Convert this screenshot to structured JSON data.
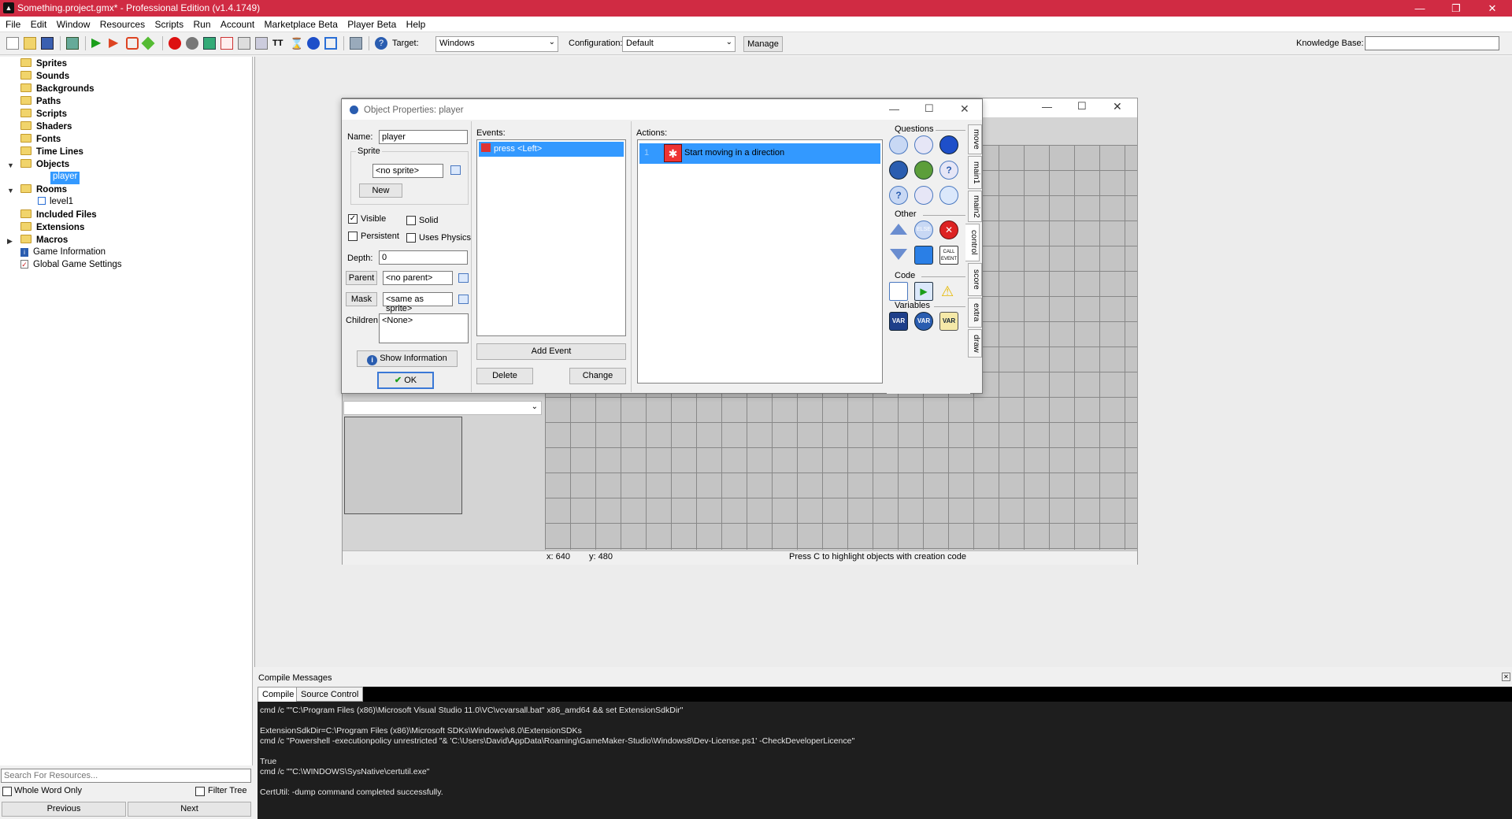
{
  "window": {
    "title": "Something.project.gmx* - Professional Edition (v1.4.1749)"
  },
  "menu": [
    "File",
    "Edit",
    "Window",
    "Resources",
    "Scripts",
    "Run",
    "Account",
    "Marketplace Beta",
    "Player Beta",
    "Help"
  ],
  "toolbar": {
    "target_label": "Target:",
    "target_value": "Windows",
    "config_label": "Configuration:",
    "config_value": "Default",
    "manage_label": "Manage",
    "kb_label": "Knowledge Base:"
  },
  "tree": {
    "sprites": "Sprites",
    "sounds": "Sounds",
    "backgrounds": "Backgrounds",
    "paths": "Paths",
    "scripts": "Scripts",
    "shaders": "Shaders",
    "fonts": "Fonts",
    "timelines": "Time Lines",
    "objects": "Objects",
    "player": "player",
    "rooms": "Rooms",
    "level1": "level1",
    "included": "Included Files",
    "extensions": "Extensions",
    "macros": "Macros",
    "gameinfo": "Game Information",
    "globalsettings": "Global Game Settings"
  },
  "search": {
    "placeholder": "Search For Resources...",
    "whole_word": "Whole Word Only",
    "filter_tree": "Filter Tree",
    "previous": "Previous",
    "next": "Next"
  },
  "dialog": {
    "title": "Object Properties: player",
    "name_label": "Name:",
    "name_value": "player",
    "sprite_group": "Sprite",
    "sprite_value": "<no sprite>",
    "new_btn": "New",
    "visible": "Visible",
    "solid": "Solid",
    "persistent": "Persistent",
    "uses_physics": "Uses Physics",
    "depth_label": "Depth:",
    "depth_value": "0",
    "parent_btn": "Parent",
    "parent_value": "<no parent>",
    "mask_btn": "Mask",
    "mask_value": "<same as sprite>",
    "children_label": "Children:",
    "children_value": "<None>",
    "show_info": "Show Information",
    "ok": "OK",
    "events_label": "Events:",
    "event_item": "press <Left>",
    "add_event": "Add Event",
    "delete": "Delete",
    "change": "Change",
    "actions_label": "Actions:",
    "action_item": "Start moving in a direction",
    "questions": "Questions",
    "other": "Other",
    "code": "Code",
    "variables": "Variables",
    "tabs": [
      "move",
      "main1",
      "main2",
      "control",
      "score",
      "extra",
      "draw"
    ],
    "else_text": "ELSE",
    "call_event": "CALL EVENT",
    "var": "VAR"
  },
  "room": {
    "x": "x: 640",
    "y": "y: 480",
    "hint": "Press C to highlight objects with creation code"
  },
  "compile": {
    "title": "Compile Messages",
    "tab_compile": "Compile",
    "tab_source": "Source Control",
    "lines": [
      "cmd /c \"\"C:\\Program Files (x86)\\Microsoft Visual Studio 11.0\\VC\\vcvarsall.bat\" x86_amd64 && set ExtensionSdkDir\"",
      "",
      "ExtensionSdkDir=C:\\Program Files (x86)\\Microsoft SDKs\\Windows\\v8.0\\ExtensionSDKs",
      "cmd /c \"Powershell -executionpolicy unrestricted \"& 'C:\\Users\\David\\AppData\\Roaming\\GameMaker-Studio\\Windows8\\Dev-License.ps1' -CheckDeveloperLicence\"",
      "",
      "True",
      "cmd /c \"\"C:\\WINDOWS\\SysNative\\certutil.exe\"",
      "",
      "CertUtil: -dump command completed successfully."
    ]
  },
  "colors": {
    "titlebar": "#d02b43",
    "selection": "#3399ff"
  }
}
